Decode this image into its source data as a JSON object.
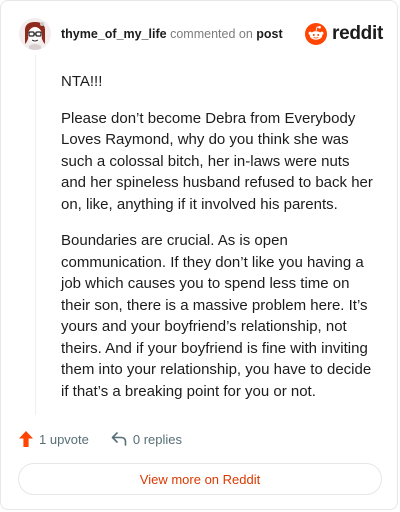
{
  "header": {
    "username": "thyme_of_my_life",
    "commented_on": "commented on",
    "post_link": "post",
    "brand": "reddit"
  },
  "comment": {
    "paragraphs": [
      "NTA!!!",
      "Please don’t become Debra from Everybody Loves Raymond, why do you think she was such a colossal bitch, her in-laws were nuts and her spineless husband refused to back her on, like, anything if it involved his parents.",
      "Boundaries are crucial. As is open communication. If they don’t like you having a job which causes you to spend less time on their son, there is a massive problem here. It’s yours and your boyfriend’s relationship, not theirs. And if your boyfriend is fine with inviting them into your relationship, you have to decide if that’s a breaking point for you or not."
    ]
  },
  "actions": {
    "upvote_label": "1 upvote",
    "replies_label": "0 replies"
  },
  "footer": {
    "view_button": "View more on Reddit"
  },
  "colors": {
    "accent": "#d93a00",
    "upvote": "#ff4500",
    "text": "#1c1c1c",
    "muted": "#576f76"
  },
  "icons": {
    "avatar": "snoo-avatar-icon",
    "brand": "reddit-logo-icon",
    "upvote": "upvote-arrow-icon",
    "reply": "reply-arrow-icon"
  }
}
